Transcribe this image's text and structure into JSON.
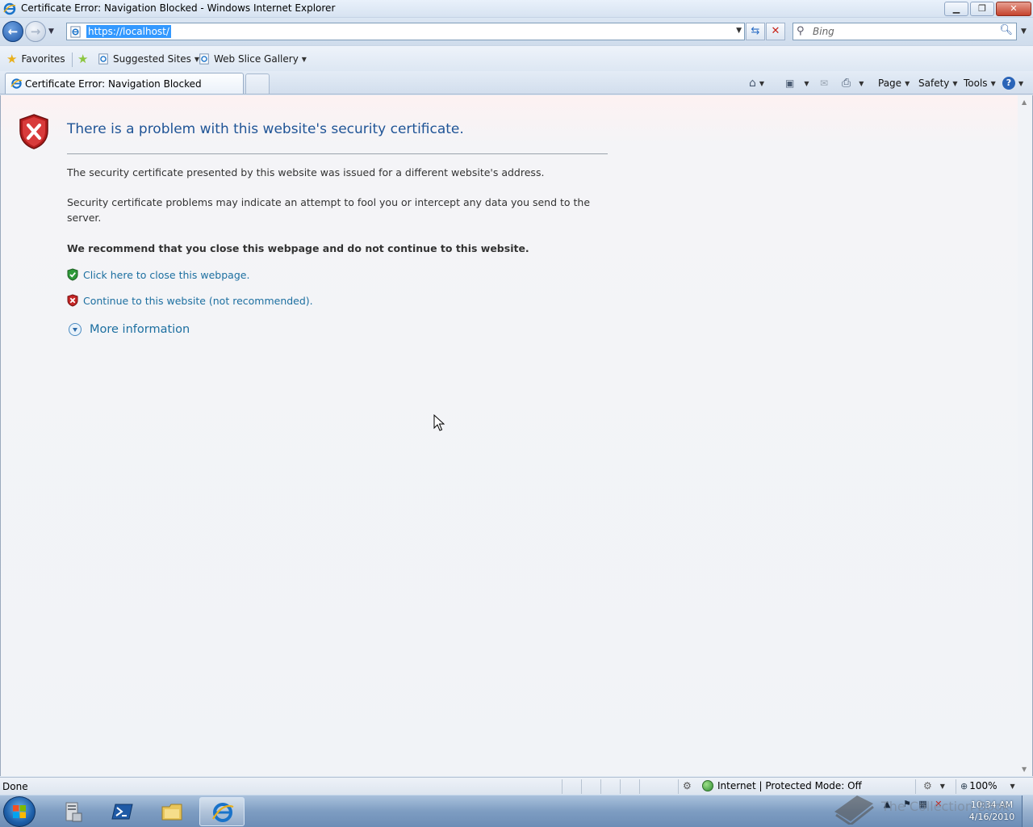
{
  "window": {
    "title": "Certificate Error: Navigation Blocked - Windows Internet Explorer",
    "minimize_label": "▁",
    "restore_label": "❐",
    "close_label": "✕"
  },
  "addressbar": {
    "url": "https://localhost/",
    "search_placeholder": "Bing"
  },
  "favorites_bar": {
    "favorites_label": "Favorites",
    "suggested_sites_label": "Suggested Sites",
    "web_slice_gallery_label": "Web Slice Gallery"
  },
  "tab": {
    "label": "Certificate Error: Navigation Blocked"
  },
  "command_bar": {
    "page_label": "Page",
    "safety_label": "Safety",
    "tools_label": "Tools"
  },
  "error_page": {
    "title": "There is a problem with this website's security certificate.",
    "paragraph1": "The security certificate presented by this website was issued for a different website's address.",
    "paragraph2": "Security certificate problems may indicate an attempt to fool you or intercept any data you send to the server.",
    "recommendation": "We recommend that you close this webpage and do not continue to this website.",
    "close_link": "Click here to close this webpage.",
    "continue_link": "Continue to this website (not recommended).",
    "more_info": "More information"
  },
  "statusbar": {
    "status": "Done",
    "zone": "Internet | Protected Mode: Off",
    "zoom": "100%"
  },
  "taskbar": {
    "time": "10:34 AM",
    "date": "4/16/2010"
  },
  "watermark": {
    "text": "The Collection Book"
  },
  "colors": {
    "link": "#1c6fa0",
    "title": "#1f5496",
    "url_highlight": "#3399ff",
    "error_red": "#c8231a"
  }
}
